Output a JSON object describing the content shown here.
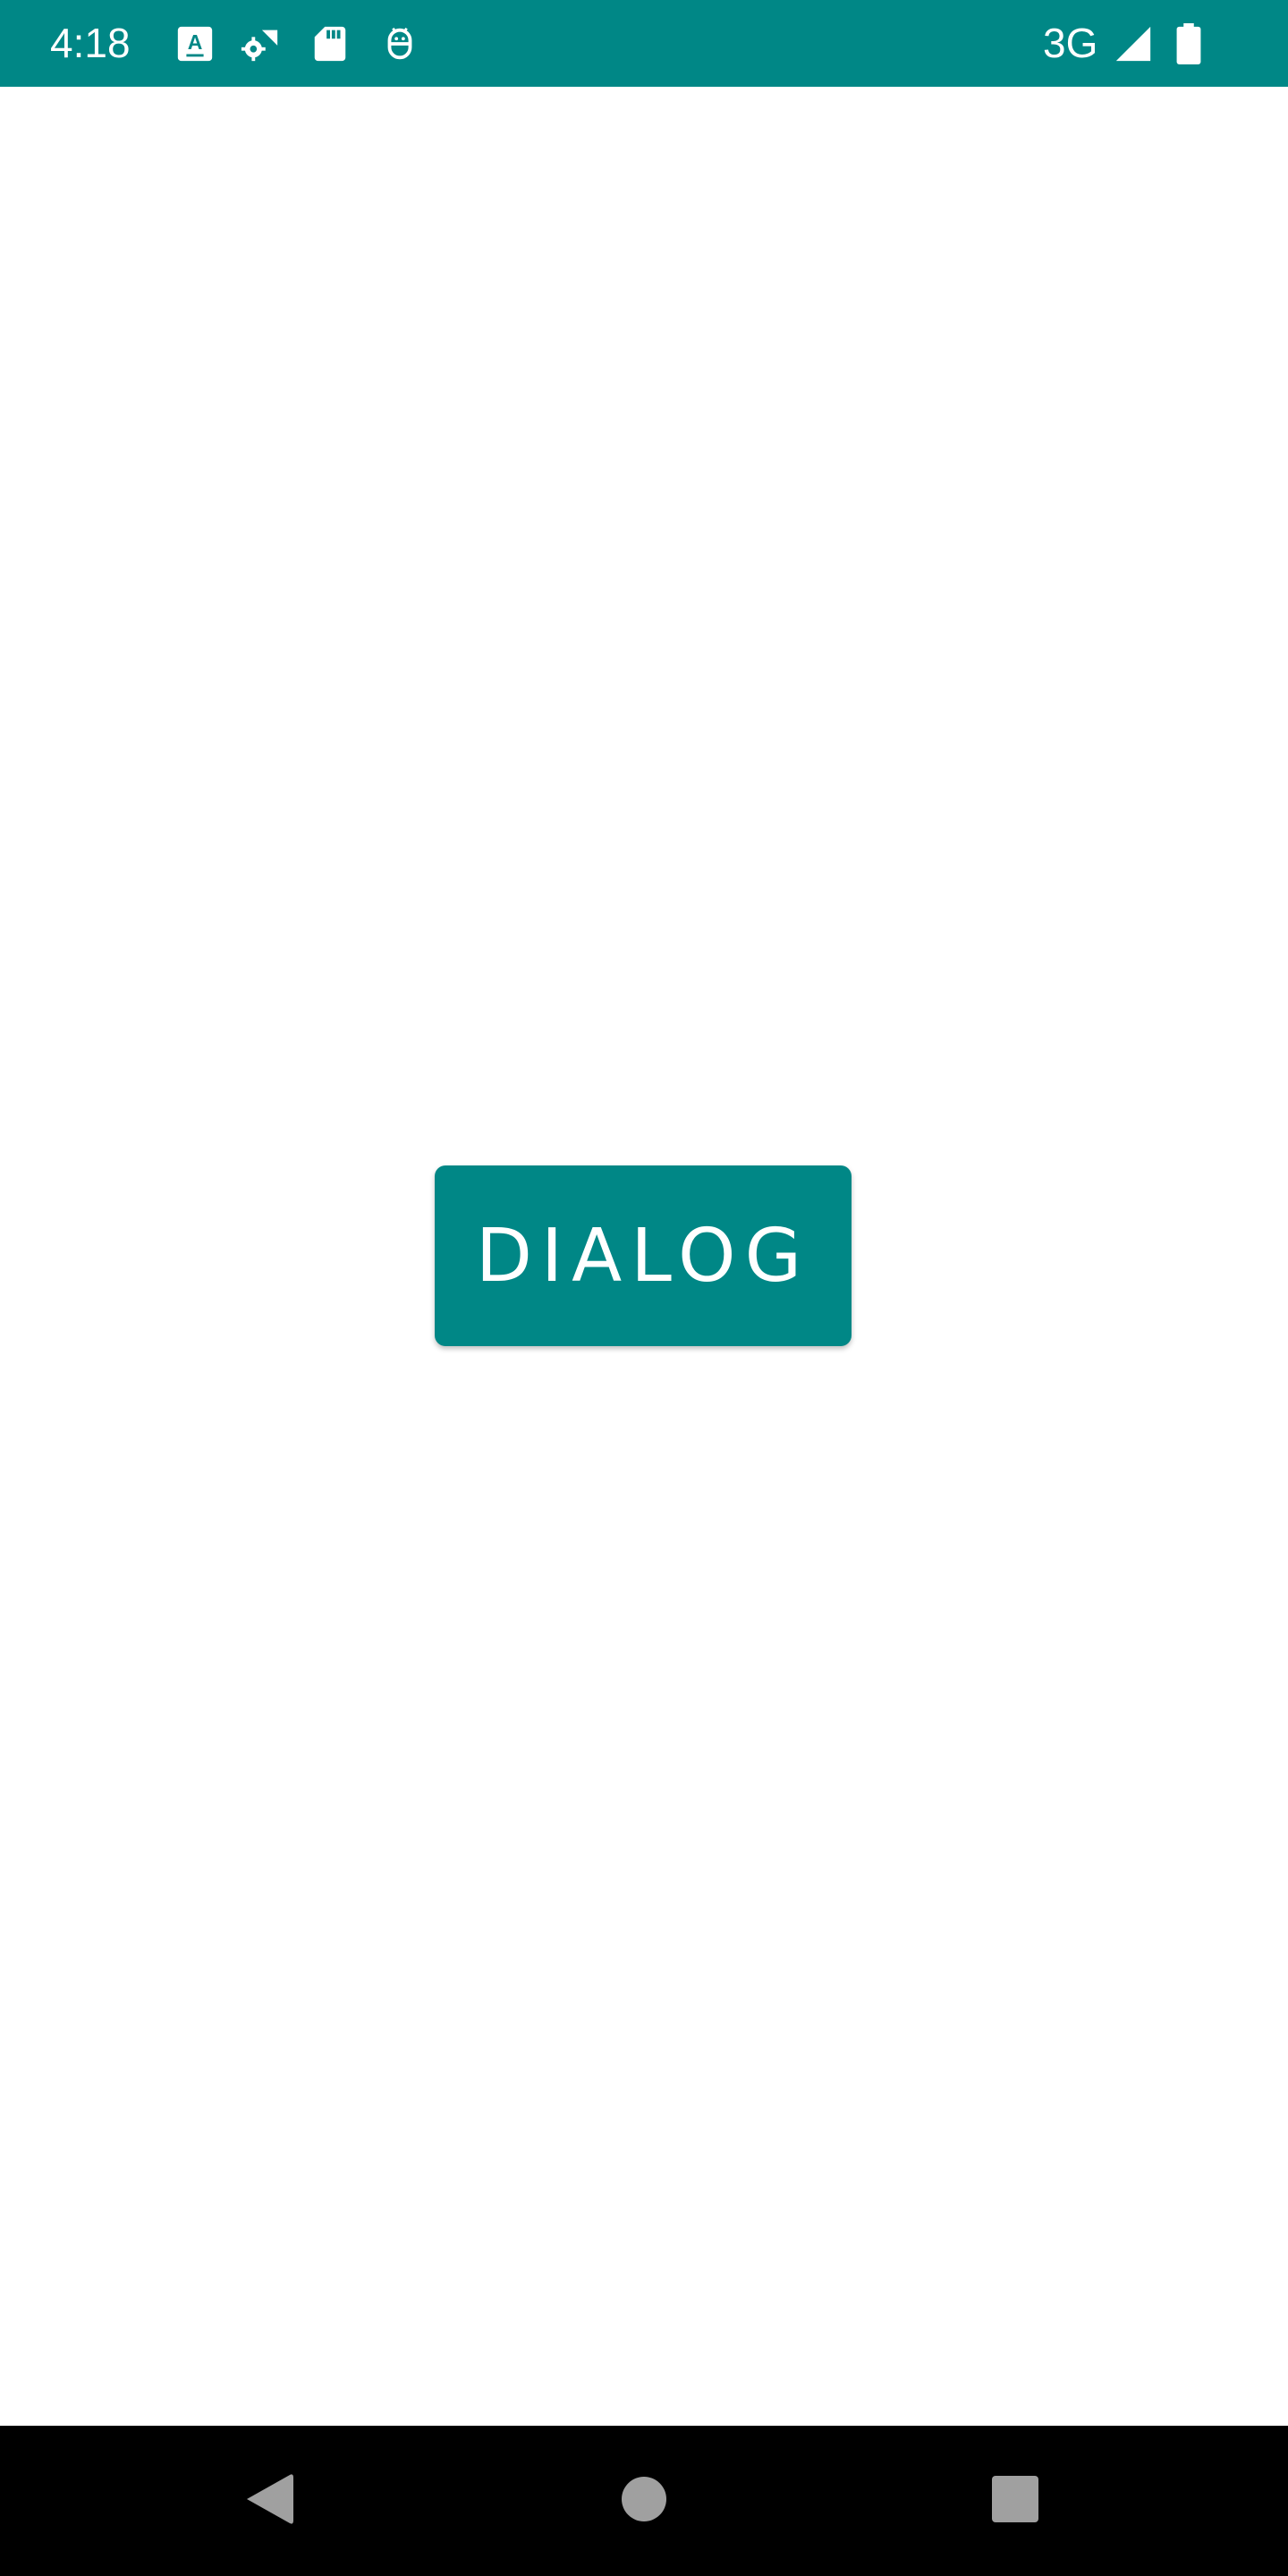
{
  "status_bar": {
    "time": "4:18",
    "network": "3G",
    "background_color": "#008786",
    "icons": [
      "text-a-icon",
      "settings-wifi-icon",
      "sd-card-icon",
      "android-debug-icon",
      "signal-icon",
      "battery-icon"
    ]
  },
  "main": {
    "dialog_button_label": "DIALOG",
    "button_color": "#008786"
  },
  "nav_bar": {
    "back": "back-icon",
    "home": "home-icon",
    "recents": "recents-icon"
  }
}
